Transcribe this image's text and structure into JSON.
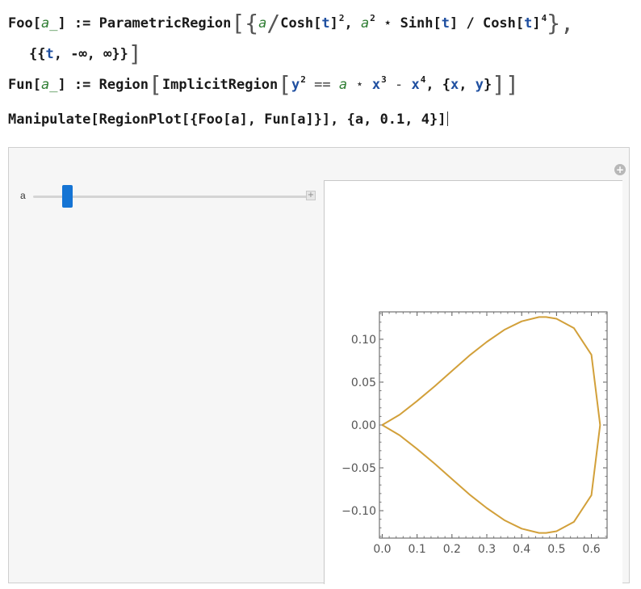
{
  "code": {
    "line1": {
      "a": "Foo[",
      "b": "a_",
      "c": "] := ParametricRegion",
      "d": "[",
      "e": "{",
      "f": "a",
      "g": "/",
      "h": "Cosh[",
      "i": "t",
      "j": "]",
      "k": "2",
      "l": ", ",
      "m": "a",
      "n": "2",
      "o": " ⋆ Sinh[",
      "p": "t",
      "q": "] / Cosh[",
      "r": "t",
      "s": "]",
      "t": "4",
      "u": "},"
    },
    "line2": {
      "a": "{{",
      "b": "t",
      "c": ", -∞, ∞}}",
      "d": "]"
    },
    "line3": {
      "a": "Fun[",
      "b": "a_",
      "c": "] := Region",
      "d": "[",
      "e": "ImplicitRegion",
      "f": "[",
      "g": "y",
      "h": "2",
      "i": " == ",
      "j": "a",
      "k": " ⋆ ",
      "l": "x",
      "m": "3",
      "n": " - ",
      "o": "x",
      "p": "4",
      "q": ", {",
      "r": "x",
      "s": ", ",
      "t": "y",
      "u": "}",
      "v": "]]"
    },
    "line4": {
      "a": "Manipulate[RegionPlot[{Foo[a], Fun[a]}], {a, 0.1, 4}]"
    }
  },
  "manipulate": {
    "slider_label": "a",
    "slider_value": 0.17,
    "slider_min": 0.1,
    "slider_max": 4,
    "plus_icon": "+",
    "slider_plus": "+"
  },
  "colors": {
    "curve": "#d2a03a",
    "thumb": "#1574d4"
  },
  "chart_data": {
    "type": "line",
    "title": "",
    "xlabel": "",
    "ylabel": "",
    "xlim": [
      -0.008,
      0.645
    ],
    "ylim": [
      -0.132,
      0.132
    ],
    "x_ticks": [
      "0.0",
      "0.1",
      "0.2",
      "0.3",
      "0.4",
      "0.5",
      "0.6"
    ],
    "y_ticks": [
      "−0.10",
      "−0.05",
      "0.00",
      "0.05",
      "0.10"
    ],
    "series": [
      {
        "x": [
          0.0,
          0.05,
          0.1,
          0.15,
          0.2,
          0.25,
          0.3,
          0.35,
          0.4,
          0.45,
          0.47,
          0.5,
          0.55,
          0.6,
          0.625
        ],
        "y": [
          0.0,
          0.012,
          0.028,
          0.045,
          0.063,
          0.081,
          0.097,
          0.111,
          0.121,
          0.126,
          0.126,
          0.124,
          0.113,
          0.082,
          0.0
        ]
      },
      {
        "x": [
          0.0,
          0.05,
          0.1,
          0.15,
          0.2,
          0.25,
          0.3,
          0.35,
          0.4,
          0.45,
          0.47,
          0.5,
          0.55,
          0.6,
          0.625
        ],
        "y": [
          0.0,
          -0.012,
          -0.028,
          -0.045,
          -0.063,
          -0.081,
          -0.097,
          -0.111,
          -0.121,
          -0.126,
          -0.126,
          -0.124,
          -0.113,
          -0.082,
          0.0
        ]
      }
    ]
  }
}
